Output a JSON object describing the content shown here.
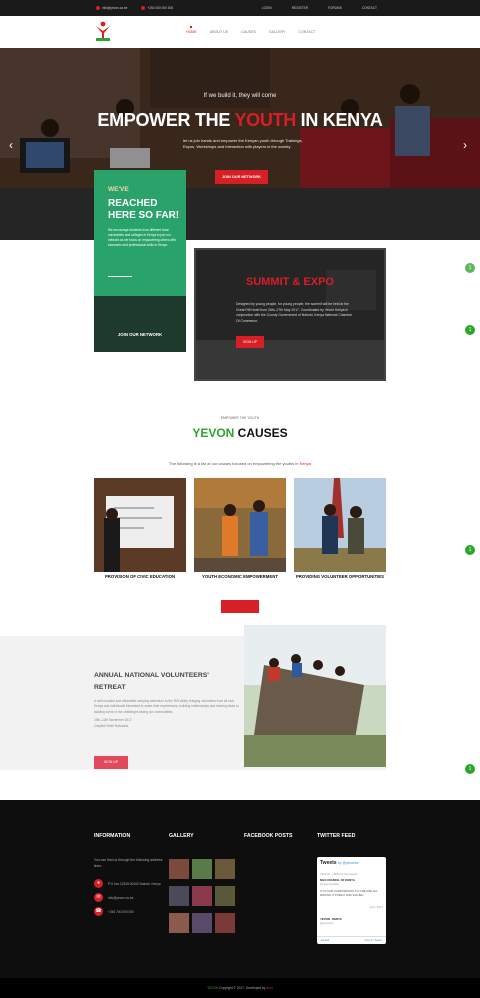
{
  "topbar": {
    "email": "info@yevon.co.ke",
    "phone": "+254 000 000 000",
    "links": [
      "LOGIN",
      "REGISTER",
      "FORUMS",
      "CONTACT"
    ]
  },
  "nav": {
    "items": [
      "HOME",
      "ABOUT US",
      "CAUSES",
      "GALLERY",
      "CONTACT"
    ]
  },
  "hero": {
    "kicker": "If we build it, they will come",
    "title_pre": "EMPOWER THE ",
    "title_red": "YOUTH",
    "title_post": " IN KENYA",
    "subtitle": "let us join hands and empower the Kenyan youth through Trainings, Expos, Workshops and Interaction with players in the society",
    "cta": "JOIN OUR NETWORK"
  },
  "reached": {
    "kicker": "WE'VE",
    "title": "REACHED\nHERE SO FAR!",
    "body": "We encourage students from different local universities and colleges in Kenya to join our network as we focus on empowering others with economic and professional skills in Kenya.",
    "cta": "JOIN OUR NETWORK"
  },
  "summit": {
    "title": "SUMMIT & EXPO",
    "body": "Designed by young people, for young people, the summit will be held at the Great Rift Hotel from 26th–27th May 2017. Coordinated by Yevon Kenya in conjunction with the County Government of Nairobi, Kenya National Chamber Of Commerce.",
    "cta": "SIGN UP"
  },
  "causes": {
    "kicker": "EMPOWER THE YOUTH",
    "title_green": "YEVON",
    "title_rest": " CAUSES",
    "desc_pre": "The following is a list of our causes focused on empowering the youths in ",
    "desc_red": "Kenya",
    "items": [
      "PROVISION OF CIVIC EDUCATION",
      "YOUTH ECONOMIC EMPOWERMENT",
      "PROVIDING VOLUNTEER OPPORTUNITIES"
    ]
  },
  "retreat": {
    "title": "ANNUAL NATIONAL VOLUNTEERS' RETREAT",
    "body": "A well rounded and affordable camping adventure to the Rift Valley bringing volunteers from all over Kenya and individuals interested to share their experiences, building relationships and sharing ideas to tackling some of the challenges facing our communities.",
    "date": "10th–12th November 2017",
    "venue": "Crayfish Hotel Naivasha",
    "cta": "SIGN UP"
  },
  "footer": {
    "info_h": "INFORMATION",
    "gallery_h": "GALLERY",
    "fb_h": "FACEBOOK POSTS",
    "tw_h": "TWITTER FEED",
    "info_text": "You can find us through the following address lines:",
    "address": "P.O box 12345-00100 Nairobi, Kenya",
    "email": "info@yevon.co.ke",
    "phone": "+254 700 000 000"
  },
  "twitter": {
    "title": "Tweets",
    "by": "by @yevonke",
    "t1_name": "YEVON · 100% for Volunteers",
    "t2_name": "NGO COUNCIL OF KENYA",
    "t2_handle": "@ngocouncilke",
    "t3": "IT IS OUR CORPORATION TO ONE AND ALL MAKING IT PUBLIC AND VALUED",
    "date": "Jul 6, 2017",
    "t4_name": "YEVON - KENYA",
    "t4_handle": "@yevonke",
    "embed": "Embed",
    "view": "View on Twitter"
  },
  "copyright": {
    "pre": "YEVON",
    "mid": " Copyright © 2017. Developed by ",
    "dev": "ixnet"
  },
  "colors": {
    "red": "#d71f26",
    "green": "#2aa36b",
    "dark": "#0e0e0e"
  }
}
